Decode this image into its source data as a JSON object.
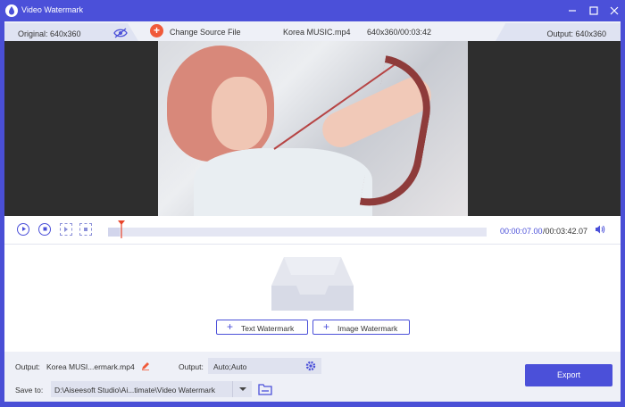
{
  "window": {
    "title": "Video Watermark",
    "icon": "water-drop-icon",
    "controls": [
      "minimize",
      "maximize",
      "close"
    ]
  },
  "info_bar": {
    "original_label": "Original: 640x360",
    "change_source_label": "Change Source File",
    "file_name": "Korea MUSIC.mp4",
    "file_meta": "640x360/00:03:42",
    "output_label": "Output: 640x360"
  },
  "player": {
    "current_time": "00:00:07.00",
    "total_time": "/00:03:42.07",
    "progress": 0.03
  },
  "watermark": {
    "text_button": "Text Watermark",
    "image_button": "Image Watermark"
  },
  "bottom": {
    "output_label": "Output:",
    "output_file": "Korea MUSI...ermark.mp4",
    "output_format_label": "Output:",
    "output_format": "Auto;Auto",
    "save_to_label": "Save to:",
    "save_path": "D:\\Aiseesoft Studio\\Ai...timate\\Video Watermark",
    "export_label": "Export"
  },
  "colors": {
    "accent": "#4b50d9",
    "add_button": "#f05a3a",
    "video_bg": "#2e2e2e"
  }
}
